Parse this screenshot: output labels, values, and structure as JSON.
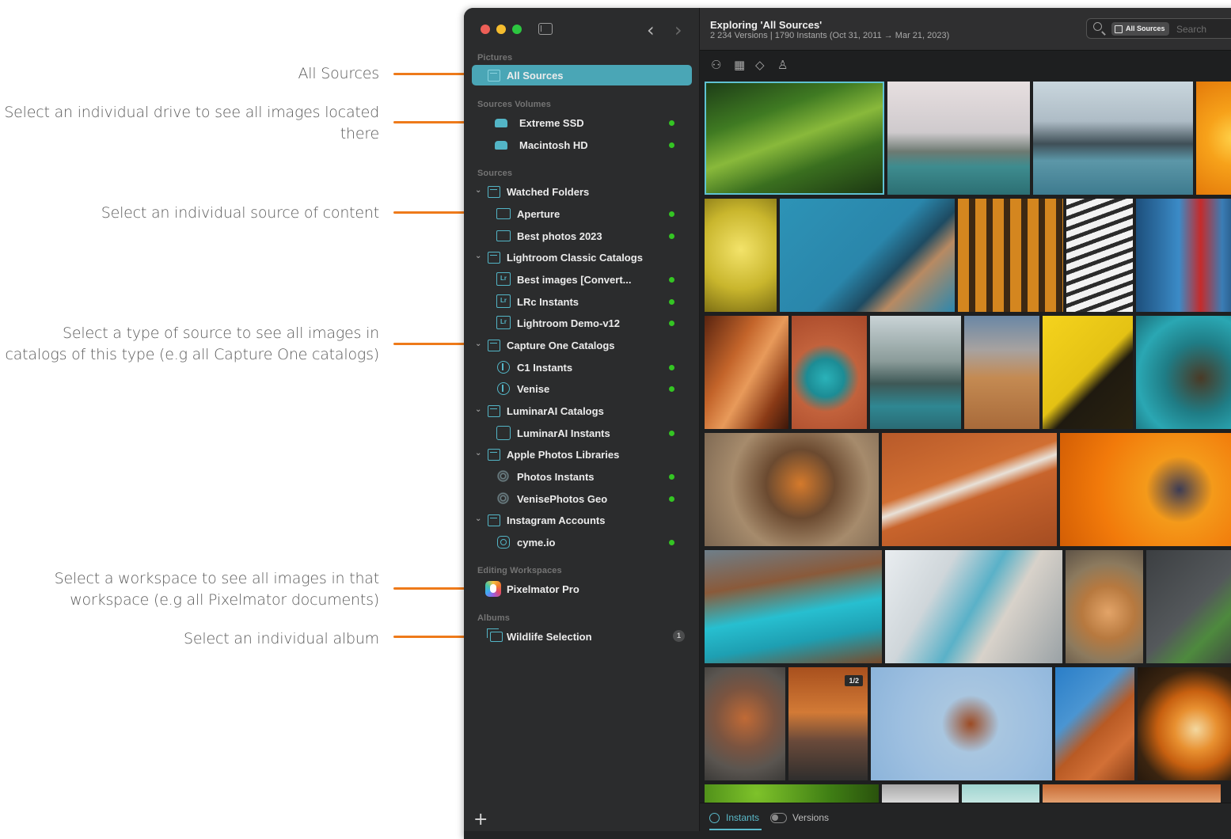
{
  "annotations": [
    {
      "text": "All Sources"
    },
    {
      "text": "Select an individual drive to see all images located there"
    },
    {
      "text": "Select an individual source of content"
    },
    {
      "text": "Select a type of source to see all images in catalogs of this type (e.g all Capture One catalogs)"
    },
    {
      "text": "Select a workspace to see all images in that workspace (e.g all Pixelmator documents)"
    },
    {
      "text": "Select an individual album"
    }
  ],
  "colors": {
    "accent": "#4aa6b6",
    "annotation_line": "#ee7a1a",
    "status_ok": "#34c523"
  },
  "sidebar": {
    "sections": {
      "pictures": "Pictures",
      "volumes": "Sources Volumes",
      "sources": "Sources",
      "workspaces": "Editing Workspaces",
      "albums": "Albums"
    },
    "items": [
      {
        "label": "All Sources",
        "icon": "archive-icon"
      },
      {
        "label": "Extreme SSD",
        "icon": "drive-icon"
      },
      {
        "label": "Macintosh HD",
        "icon": "drive-icon"
      },
      {
        "label": "Watched Folders",
        "icon": "archive-icon"
      },
      {
        "label": "Aperture",
        "icon": "folder-icon"
      },
      {
        "label": "Best photos 2023",
        "icon": "folder-icon"
      },
      {
        "label": "Lightroom Classic Catalogs",
        "icon": "archive-icon"
      },
      {
        "label": "Best images [Convert...",
        "icon": "lightroom-icon"
      },
      {
        "label": "LRc Instants",
        "icon": "lightroom-icon"
      },
      {
        "label": "Lightroom Demo-v12",
        "icon": "lightroom-icon"
      },
      {
        "label": "Capture One Catalogs",
        "icon": "archive-icon"
      },
      {
        "label": "C1 Instants",
        "icon": "capture-one-icon"
      },
      {
        "label": "Venise",
        "icon": "capture-one-icon"
      },
      {
        "label": "LuminarAI Catalogs",
        "icon": "archive-icon"
      },
      {
        "label": "LuminarAI Instants",
        "icon": "luminar-icon"
      },
      {
        "label": "Apple Photos Libraries",
        "icon": "archive-icon"
      },
      {
        "label": "Photos Instants",
        "icon": "photos-icon"
      },
      {
        "label": "VenisePhotos Geo",
        "icon": "photos-icon"
      },
      {
        "label": "Instagram Accounts",
        "icon": "archive-icon"
      },
      {
        "label": "cyme.io",
        "icon": "instagram-icon"
      },
      {
        "label": "Pixelmator Pro",
        "icon": "pixelmator-icon"
      },
      {
        "label": "Wildlife Selection",
        "icon": "album-icon",
        "count": "1"
      }
    ],
    "lightroom_glyph": "Lr"
  },
  "header": {
    "title": "Exploring 'All Sources'",
    "subtitle": "2 234 Versions | 1790 Instants (Oct 31, 2011 → Mar 21, 2023)",
    "search_scope": "All Sources",
    "search_placeholder": "Search"
  },
  "grid": {
    "badge": "1/2"
  },
  "footer": {
    "instants": "Instants",
    "versions": "Versions"
  }
}
